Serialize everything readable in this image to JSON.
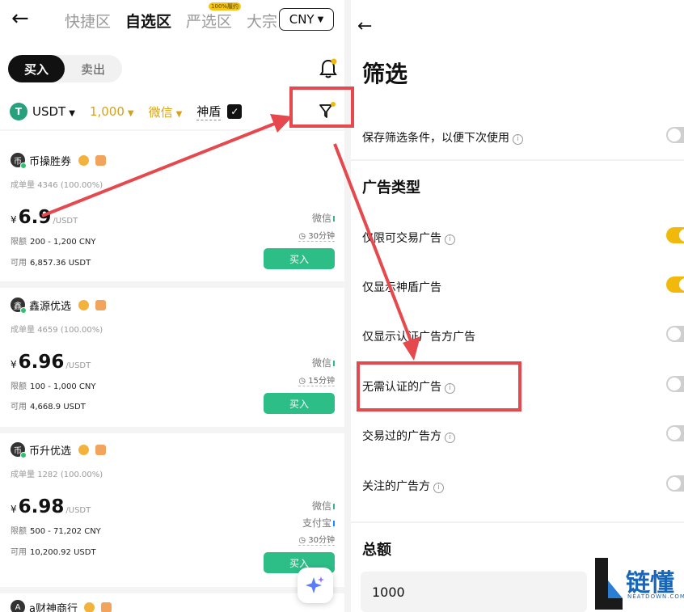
{
  "left": {
    "nav_tabs": [
      "快捷区",
      "自选区",
      "严选区",
      "大宗"
    ],
    "active_tab": "自选区",
    "nav_tag": "100%履约",
    "currency": "CNY",
    "segment": {
      "buy": "买入",
      "sell": "卖出"
    },
    "filters": {
      "coin": "USDT",
      "amount": "1,000",
      "payment": "微信",
      "shield": "神盾"
    },
    "merchants": [
      {
        "name": "币操胜券",
        "stats_label": "成单量",
        "stats": "4346 (100.00%)",
        "currency_symbol": "¥",
        "price": "6.9",
        "unit": "/USDT",
        "limit_label": "限额",
        "limit": "200 - 1,200 CNY",
        "avail_label": "可用",
        "available": "6,857.36 USDT",
        "payments": [
          "微信"
        ],
        "time": "30分钟",
        "button": "买入"
      },
      {
        "name": "鑫源优选",
        "stats_label": "成单量",
        "stats": "4659 (100.00%)",
        "currency_symbol": "¥",
        "price": "6.96",
        "unit": "/USDT",
        "limit_label": "限额",
        "limit": "100 - 1,000 CNY",
        "avail_label": "可用",
        "available": "4,668.9 USDT",
        "payments": [
          "微信"
        ],
        "time": "15分钟",
        "button": "买入"
      },
      {
        "name": "币升优选",
        "stats_label": "成单量",
        "stats": "1282 (100.00%)",
        "currency_symbol": "¥",
        "price": "6.98",
        "unit": "/USDT",
        "limit_label": "限额",
        "limit": "500 - 71,202 CNY",
        "avail_label": "可用",
        "available": "10,200.92 USDT",
        "payments": [
          "微信",
          "支付宝"
        ],
        "time": "30分钟",
        "button": "买入"
      },
      {
        "name": "a财神商行"
      }
    ]
  },
  "right": {
    "title": "筛选",
    "save_label": "保存筛选条件，以便下次使用",
    "save_on": false,
    "section_ad_type": "广告类型",
    "options": [
      {
        "label": "仅限可交易广告",
        "info": true,
        "on": true
      },
      {
        "label": "仅显示神盾广告",
        "info": false,
        "on": true
      },
      {
        "label": "仅显示认证广告方广告",
        "info": false,
        "on": false
      },
      {
        "label": "无需认证的广告",
        "info": true,
        "on": false
      },
      {
        "label": "交易过的广告方",
        "info": true,
        "on": false
      },
      {
        "label": "关注的广告方",
        "info": true,
        "on": false
      }
    ],
    "section_amount": "总额",
    "amount_value": "1000"
  },
  "watermark": {
    "name": "链懂",
    "domain": "NEATDOWN.COM"
  },
  "colors": {
    "accent_yellow": "#f0b90b",
    "buy_green": "#2dbd86",
    "highlight_red": "#e5484d",
    "gold_text": "#d6a21e"
  }
}
